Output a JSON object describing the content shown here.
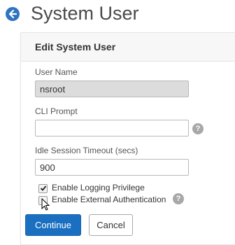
{
  "header": {
    "title": "System User"
  },
  "form": {
    "title": "Edit System User",
    "username": {
      "label": "User Name",
      "value": "nsroot"
    },
    "cli_prompt": {
      "label": "CLI Prompt",
      "value": "",
      "help": "?"
    },
    "idle_timeout": {
      "label": "Idle Session Timeout (secs)",
      "value": "900"
    },
    "logging_privilege": {
      "label": "Enable Logging Privilege",
      "checked": true
    },
    "external_auth": {
      "label": "Enable External Authentication",
      "checked": false,
      "help": "?"
    }
  },
  "buttons": {
    "continue": "Continue",
    "cancel": "Cancel"
  },
  "colors": {
    "accent": "#1a6fc0",
    "back_icon": "#2f74c0",
    "disabled_field": "#dcdcdc"
  },
  "icons": {
    "back": "arrow-left-icon",
    "help": "help-icon",
    "check": "check-icon",
    "cursor": "mouse-pointer-icon"
  }
}
